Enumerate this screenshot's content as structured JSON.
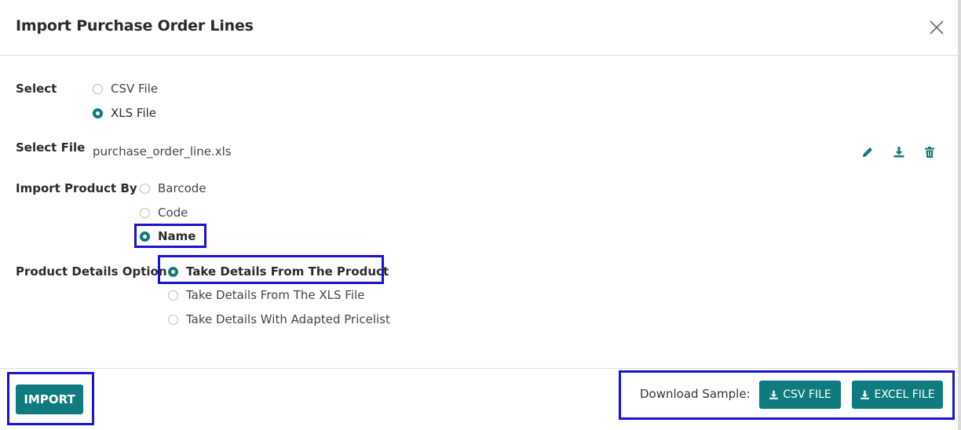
{
  "dialog": {
    "title": "Import Purchase Order Lines"
  },
  "select": {
    "label": "Select",
    "options": [
      {
        "label": "CSV File",
        "checked": false
      },
      {
        "label": "XLS File",
        "checked": true
      }
    ]
  },
  "select_file": {
    "label": "Select File",
    "filename": "purchase_order_line.xls",
    "icons": [
      "pencil-icon",
      "download-icon",
      "trash-icon"
    ]
  },
  "import_product_by": {
    "label": "Import Product By",
    "options": [
      {
        "label": "Barcode",
        "checked": false
      },
      {
        "label": "Code",
        "checked": false
      },
      {
        "label": "Name",
        "checked": true
      }
    ]
  },
  "product_details": {
    "label": "Product Details Option",
    "options": [
      {
        "label": "Take Details From The Product",
        "checked": true
      },
      {
        "label": "Take Details From The XLS File",
        "checked": false
      },
      {
        "label": "Take Details With Adapted Pricelist",
        "checked": false
      }
    ]
  },
  "footer": {
    "import_label": "IMPORT",
    "sample_label": "Download Sample:",
    "csv_button": "CSV FILE",
    "excel_button": "EXCEL FILE"
  },
  "colors": {
    "accent": "#0f7b7e",
    "highlight": "#1a12d6"
  }
}
